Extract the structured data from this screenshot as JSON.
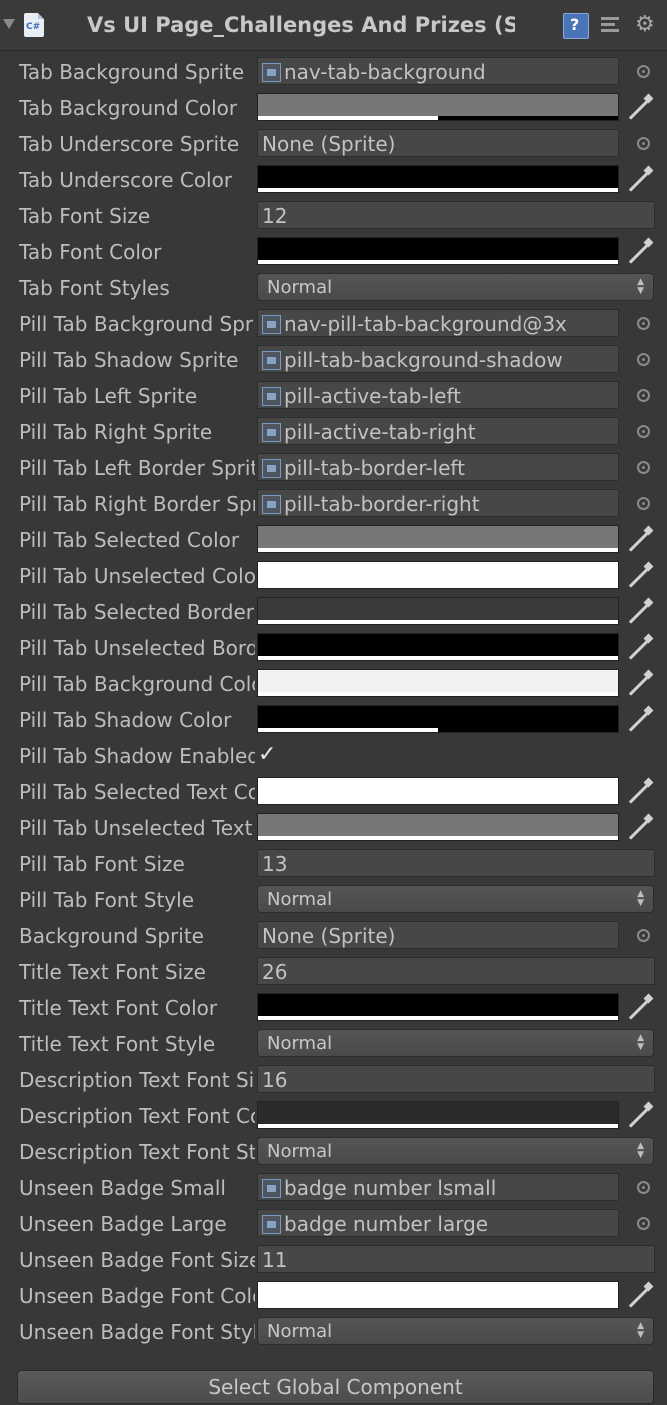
{
  "header": {
    "title": "Vs UI Page_Challenges And Prizes (Scr",
    "script_icon_text": "C#",
    "help_text": "?"
  },
  "rows": [
    {
      "label": "Tab Background Sprite",
      "type": "sprite",
      "value": "nav-tab-background"
    },
    {
      "label": "Tab Background Color",
      "type": "color",
      "color": "#777777",
      "alpha": 0.5
    },
    {
      "label": "Tab Underscore Sprite",
      "type": "sprite",
      "value": "None (Sprite)",
      "noicon": true
    },
    {
      "label": "Tab Underscore Color",
      "type": "color",
      "color": "#000000",
      "alpha": 1
    },
    {
      "label": "Tab Font Size",
      "type": "number",
      "value": "12"
    },
    {
      "label": "Tab Font Color",
      "type": "color",
      "color": "#000000",
      "alpha": 1
    },
    {
      "label": "Tab Font Styles",
      "type": "dropdown",
      "value": "Normal"
    },
    {
      "label": "Pill Tab Background Sprite",
      "type": "sprite",
      "value": "nav-pill-tab-background@3x"
    },
    {
      "label": "Pill Tab Shadow Sprite",
      "type": "sprite",
      "value": "pill-tab-background-shadow"
    },
    {
      "label": "Pill Tab Left Sprite",
      "type": "sprite",
      "value": "pill-active-tab-left"
    },
    {
      "label": "Pill Tab Right Sprite",
      "type": "sprite",
      "value": "pill-active-tab-right"
    },
    {
      "label": "Pill Tab Left Border Sprite",
      "type": "sprite",
      "value": "pill-tab-border-left"
    },
    {
      "label": "Pill Tab Right Border Sprite",
      "type": "sprite",
      "value": "pill-tab-border-right"
    },
    {
      "label": "Pill Tab Selected Color",
      "type": "color",
      "color": "#777777",
      "alpha": 1
    },
    {
      "label": "Pill Tab Unselected Color",
      "type": "color",
      "color": "#ffffff",
      "alpha": 1
    },
    {
      "label": "Pill Tab Selected Border Color",
      "type": "color",
      "color": "#3a3a3a",
      "alpha": 1
    },
    {
      "label": "Pill Tab Unselected Border Color",
      "type": "color",
      "color": "#000000",
      "alpha": 1
    },
    {
      "label": "Pill Tab Background Color",
      "type": "color",
      "color": "#f2f2f2",
      "alpha": 1
    },
    {
      "label": "Pill Tab Shadow Color",
      "type": "color",
      "color": "#000000",
      "alpha": 0.5
    },
    {
      "label": "Pill Tab Shadow Enabled",
      "type": "checkbox",
      "checked": true
    },
    {
      "label": "Pill Tab Selected Text Color",
      "type": "color",
      "color": "#ffffff",
      "alpha": 1
    },
    {
      "label": "Pill Tab Unselected Text Color",
      "type": "color",
      "color": "#777777",
      "alpha": 1
    },
    {
      "label": "Pill Tab Font Size",
      "type": "number",
      "value": "13"
    },
    {
      "label": "Pill Tab Font Style",
      "type": "dropdown",
      "value": "Normal"
    },
    {
      "label": "Background Sprite",
      "type": "sprite",
      "value": "None (Sprite)",
      "noicon": true
    },
    {
      "label": "Title Text Font Size",
      "type": "number",
      "value": "26"
    },
    {
      "label": "Title Text Font Color",
      "type": "color",
      "color": "#000000",
      "alpha": 1
    },
    {
      "label": "Title Text Font Style",
      "type": "dropdown",
      "value": "Normal"
    },
    {
      "label": "Description Text Font Size",
      "type": "number",
      "value": "16"
    },
    {
      "label": "Description Text Font Color",
      "type": "color",
      "color": "#2b2b2b",
      "alpha": 1
    },
    {
      "label": "Description Text Font Style",
      "type": "dropdown",
      "value": "Normal"
    },
    {
      "label": "Unseen Badge Small",
      "type": "sprite",
      "value": "badge number lsmall"
    },
    {
      "label": "Unseen Badge Large",
      "type": "sprite",
      "value": "badge number large"
    },
    {
      "label": "Unseen Badge Font Size",
      "type": "number",
      "value": "11"
    },
    {
      "label": "Unseen Badge Font Color",
      "type": "color",
      "color": "#ffffff",
      "alpha": 1
    },
    {
      "label": "Unseen Badge Font Style",
      "type": "dropdown",
      "value": "Normal"
    }
  ],
  "footer": {
    "button_label": "Select Global Component"
  }
}
